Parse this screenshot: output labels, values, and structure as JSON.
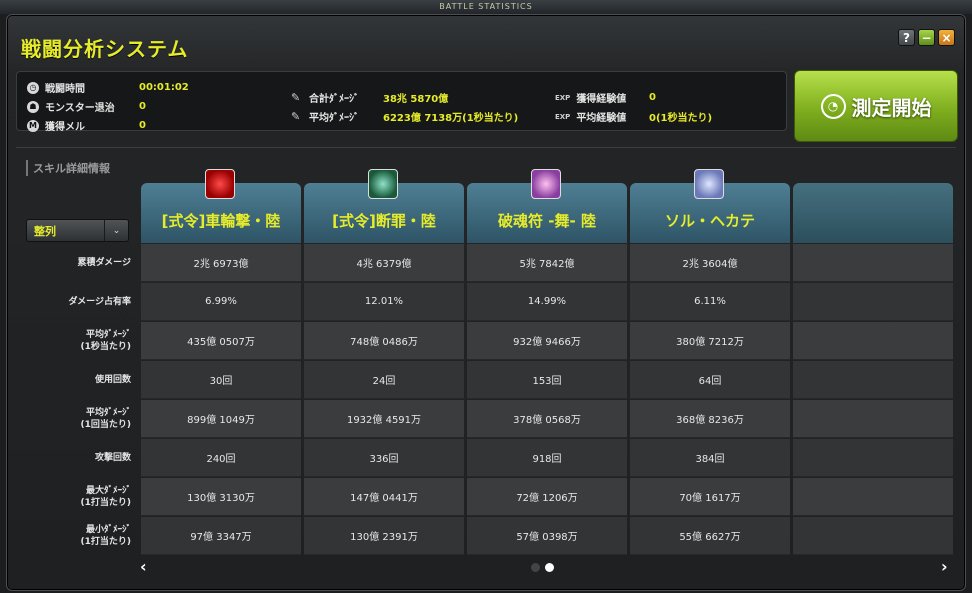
{
  "window": {
    "caption": "BATTLE STATISTICS",
    "title": "戦闘分析システム",
    "help": "?",
    "minimize": "−",
    "close": "×"
  },
  "summary": {
    "time_label": "戦闘時間",
    "time_value": "00:01:02",
    "monster_label": "モンスター退治",
    "monster_value": "0",
    "meso_label": "獲得メル",
    "meso_value": "0",
    "total_dmg_label": "合計ﾀﾞﾒｰｼﾞ",
    "total_dmg_value": "38兆 5870億",
    "avg_dmg_label": "平均ﾀﾞﾒｰｼﾞ",
    "avg_dmg_value": "6223億 7138万(1秒当たり)",
    "exp_prefix": "EXP",
    "exp_label": "獲得経験値",
    "exp_value": "0",
    "avg_exp_label": "平均経験値",
    "avg_exp_value": "0(1秒当たり)"
  },
  "start_button": "測定開始",
  "section_title": "スキル詳細情報",
  "sort": {
    "label": "整列",
    "chevron": "⌄"
  },
  "row_labels": [
    "累積ダメージ",
    "ダメージ占有率",
    "平均ﾀﾞﾒｰｼﾞ\n(1秒当たり)",
    "使用回数",
    "平均ﾀﾞﾒｰｼﾞ\n(1回当たり)",
    "攻撃回数",
    "最大ﾀﾞﾒｰｼﾞ\n(1打当たり)",
    "最小ﾀﾞﾒｰｼﾞ\n(1打当たり)"
  ],
  "skills": [
    {
      "name": "[式令]車輪撃・陸",
      "icon": "fire-wheel-icon",
      "values": [
        "2兆 6973億",
        "6.99%",
        "435億 0507万",
        "30回",
        "899億 1049万",
        "240回",
        "130億 3130万",
        "97億 3347万"
      ]
    },
    {
      "name": "[式令]断罪・陸",
      "icon": "green-slash-icon",
      "values": [
        "4兆 6379億",
        "12.01%",
        "748億 0486万",
        "24回",
        "1932億 4591万",
        "336回",
        "147億 0441万",
        "130億 2391万"
      ]
    },
    {
      "name": "破魂符 -舞- 陸",
      "icon": "pink-talisman-icon",
      "values": [
        "5兆 7842億",
        "14.99%",
        "932億 9466万",
        "153回",
        "378億 0568万",
        "918回",
        "72億 1206万",
        "57億 0398万"
      ]
    },
    {
      "name": "ソル・ヘカテ",
      "icon": "blue-spirit-icon",
      "values": [
        "2兆 3604億",
        "6.11%",
        "380億 7212万",
        "64回",
        "368億 8236万",
        "384回",
        "70億 1617万",
        "55億 6627万"
      ]
    },
    {
      "name": "",
      "icon": "",
      "values": [
        "",
        "",
        "",
        "",
        "",
        "",
        "",
        ""
      ]
    }
  ],
  "pagination": {
    "prev": "‹",
    "next": "›",
    "pages": 2,
    "current": 2
  }
}
